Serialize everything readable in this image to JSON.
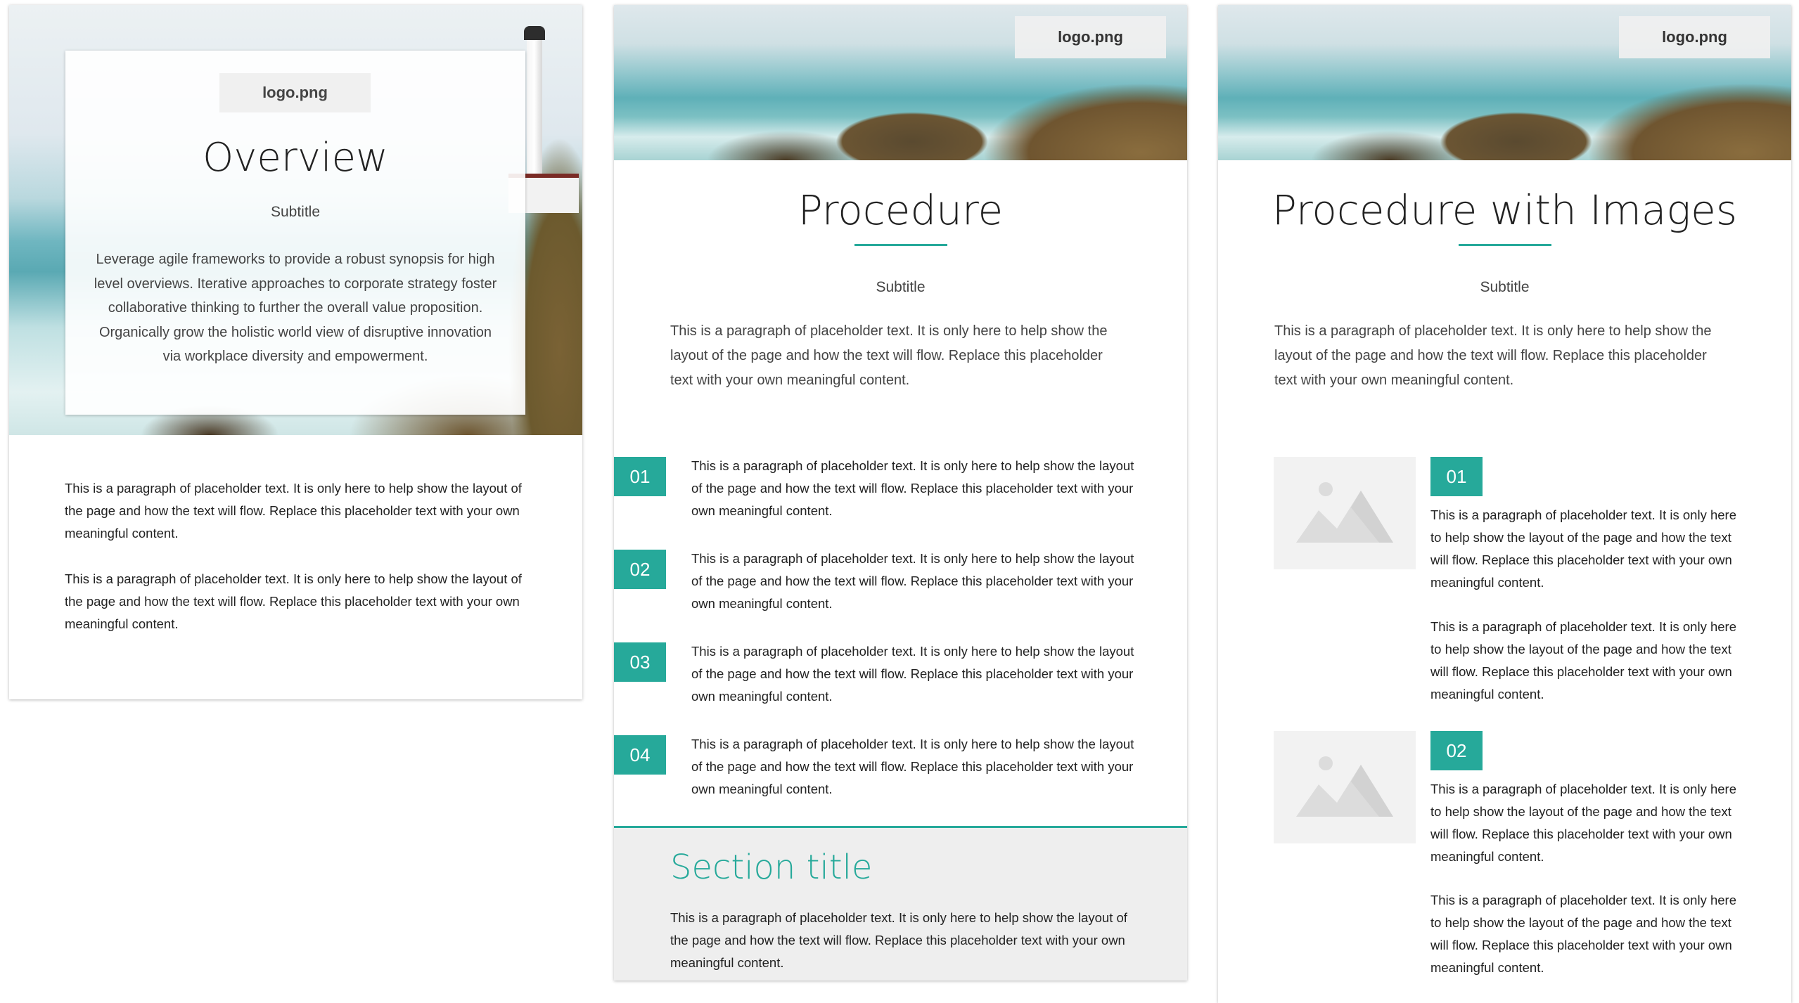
{
  "placeholder_paragraph": "This is a paragraph of placeholder text. It is only here to help show the layout of the page and how the text will flow. Replace this placeholder text with your own meaningful content.",
  "page1": {
    "logo": "logo.png",
    "title": "Overview",
    "subtitle": "Subtitle",
    "intro": "Leverage agile frameworks to provide a robust synopsis for high level overviews. Iterative approaches to corporate strategy foster collaborative thinking to further the overall value proposition. Organically grow the holistic world view of disruptive innovation via workplace diversity and empowerment.",
    "paragraphs": [
      "This is a paragraph of placeholder text. It is only here to help show the layout of the page and how the text will flow. Replace this placeholder text with your own meaningful content.",
      "This is a paragraph of placeholder text. It is only here to help show the layout of the page and how the text will flow. Replace this placeholder text with your own meaningful content."
    ]
  },
  "page2": {
    "logo": "logo.png",
    "title": "Procedure",
    "subtitle": "Subtitle",
    "intro": "This is a paragraph of placeholder text. It is only here to help show the layout of the page and how the text will flow. Replace this placeholder text with your own meaningful content.",
    "steps": [
      {
        "num": "01",
        "text": "This is a paragraph of placeholder text. It is only here to help show the layout of the page and how the text will flow. Replace this placeholder text with your own meaningful content."
      },
      {
        "num": "02",
        "text": "This is a paragraph of placeholder text. It is only here to help show the layout of the page and how the text will flow. Replace this placeholder text with your own meaningful content."
      },
      {
        "num": "03",
        "text": "This is a paragraph of placeholder text. It is only here to help show the layout of the page and how the text will flow. Replace this placeholder text with your own meaningful content."
      },
      {
        "num": "04",
        "text": "This is a paragraph of placeholder text. It is only here to help show the layout of the page and how the text will flow. Replace this placeholder text with your own meaningful content."
      }
    ],
    "section": {
      "title": "Section title",
      "text": "This is a paragraph of placeholder text. It is only here to help show the layout of the page and how the text will flow. Replace this placeholder text with your own meaningful content."
    }
  },
  "page3": {
    "logo": "logo.png",
    "title": "Procedure with Images",
    "subtitle": "Subtitle",
    "intro": "This is a paragraph of placeholder text. It is only here to help show the layout of the page and how the text will flow. Replace this placeholder text with your own meaningful content.",
    "steps": [
      {
        "num": "01",
        "text1": "This is a paragraph of placeholder text. It is only here to help show the layout of the page and how the text will flow. Replace this placeholder text with your own meaningful content.",
        "text2": "This is a paragraph of placeholder text. It is only here to help show the layout of the page and how the text will flow. Replace this placeholder text with your own meaningful content."
      },
      {
        "num": "02",
        "text1": "This is a paragraph of placeholder text. It is only here to help show the layout of the page and how the text will flow. Replace this placeholder text with your own meaningful content.",
        "text2": "This is a paragraph of placeholder text. It is only here to help show the layout of the page and how the text will flow. Replace this placeholder text with your own meaningful content."
      }
    ]
  },
  "colors": {
    "accent": "#26a99a",
    "section_bg": "#eeeeee",
    "placeholder_bg": "#f2f2f2"
  },
  "icons": [
    "image-placeholder-icon"
  ]
}
